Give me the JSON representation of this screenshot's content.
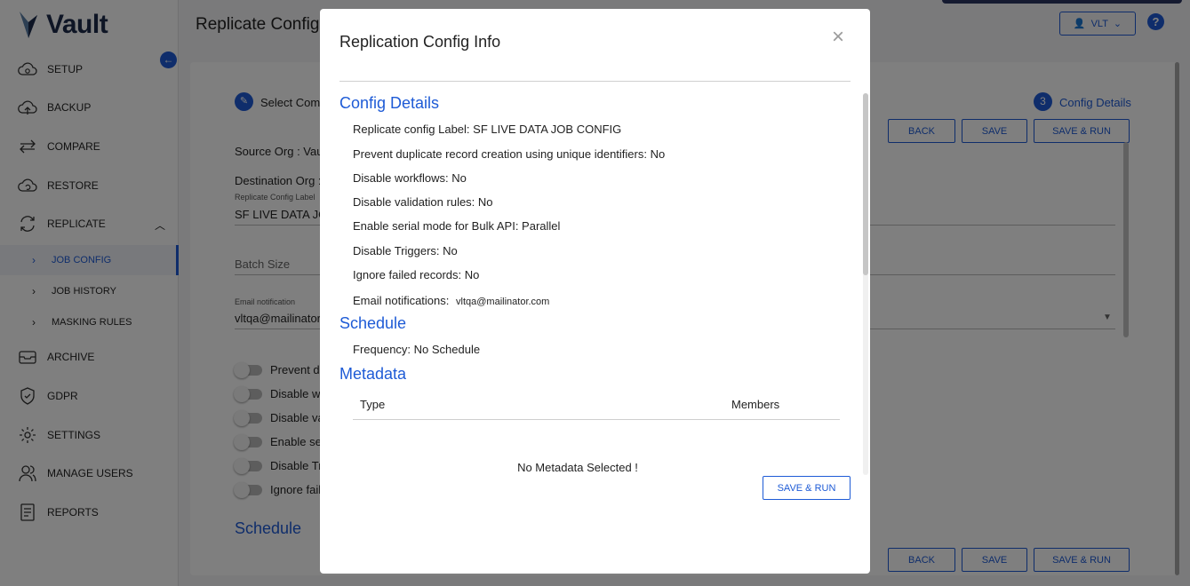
{
  "app": {
    "brand": "Vault",
    "page_title": "Replicate Config",
    "user_label": "VLT",
    "help_label": "?"
  },
  "sidebar": {
    "items": [
      {
        "label": "SETUP"
      },
      {
        "label": "BACKUP"
      },
      {
        "label": "COMPARE"
      },
      {
        "label": "RESTORE"
      },
      {
        "label": "REPLICATE"
      },
      {
        "label": "ARCHIVE"
      },
      {
        "label": "GDPR"
      },
      {
        "label": "SETTINGS"
      },
      {
        "label": "MANAGE USERS"
      },
      {
        "label": "REPORTS"
      }
    ],
    "sub_items": [
      {
        "label": "JOB CONFIG"
      },
      {
        "label": "JOB HISTORY"
      },
      {
        "label": "MASKING RULES"
      }
    ]
  },
  "background": {
    "step1_label": "Select Comp",
    "step3_number": "3",
    "step3_label": "Config Details",
    "source_org": "Source Org : Vaul",
    "destination_org": "Destination Org :",
    "config_label_caption": "Replicate Config Label",
    "config_label_value": "SF LIVE DATA JO",
    "batch_size": "Batch Size",
    "email_caption": "Email notification",
    "email_value": "vltqa@mailinator",
    "toggles": [
      "Prevent du",
      "Disable wo",
      "Disable va",
      "Enable ser",
      "Disable Tr",
      "Ignore fail"
    ],
    "schedule": "Schedule",
    "back": "BACK",
    "save": "SAVE",
    "save_run": "SAVE & RUN"
  },
  "modal": {
    "title": "Replication Config Info",
    "close": "×",
    "config_heading": "Config Details",
    "rows": [
      "Replicate config Label: SF LIVE DATA JOB CONFIG",
      "Prevent duplicate record creation using unique identifiers: No",
      "Disable workflows: No",
      "Disable validation rules: No",
      "Enable serial mode for Bulk API: Parallel",
      "Disable Triggers: No",
      "Ignore failed records: No"
    ],
    "email_label": "Email notifications:",
    "email_value": "vltqa@mailinator.com",
    "schedule_heading": "Schedule",
    "frequency": "Frequency: No Schedule",
    "metadata_heading": "Metadata",
    "col_type": "Type",
    "col_members": "Members",
    "empty_message": "No Metadata Selected !",
    "save_run": "SAVE & RUN"
  }
}
